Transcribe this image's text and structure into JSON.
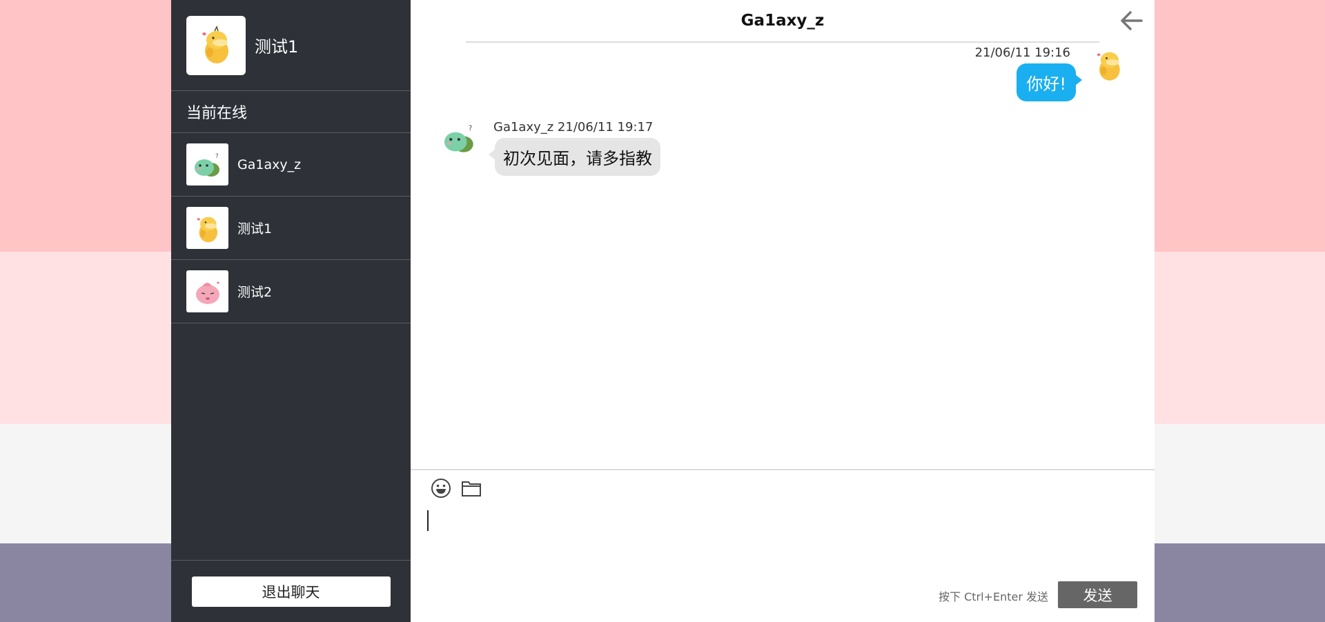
{
  "me": {
    "name": "测试1",
    "avatar_icon": "psyduck-avatar-icon"
  },
  "online": {
    "title": "当前在线",
    "users": [
      {
        "name": "Ga1axy_z",
        "avatar_icon": "bulbasaur-avatar-icon"
      },
      {
        "name": "测试1",
        "avatar_icon": "psyduck-avatar-icon"
      },
      {
        "name": "测试2",
        "avatar_icon": "jigglypuff-avatar-icon"
      }
    ]
  },
  "sidebar": {
    "logout_label": "退出聊天"
  },
  "chat": {
    "title": "Ga1axy_z",
    "back_icon": "arrow-left-icon",
    "messages": [
      {
        "side": "right",
        "meta": "21/06/11 19:16",
        "text": "你好!",
        "avatar_icon": "psyduck-avatar-icon",
        "bubble_color": "#1aaff0"
      },
      {
        "side": "left",
        "meta": "Ga1axy_z 21/06/11 19:17",
        "text": "初次见面，请多指教",
        "avatar_icon": "bulbasaur-avatar-icon",
        "bubble_color": "#e5e5e5"
      }
    ]
  },
  "composer": {
    "tools": [
      "smiley-icon",
      "folder-icon"
    ],
    "hint": "按下 Ctrl+Enter 发送",
    "send_label": "发送"
  },
  "colors": {
    "sidebar_bg": "#2e3138",
    "send_button": "#666666",
    "background_bands": [
      "#ffc4c6",
      "#ffe1e3",
      "#f5f5f5",
      "#8a86a2"
    ]
  }
}
